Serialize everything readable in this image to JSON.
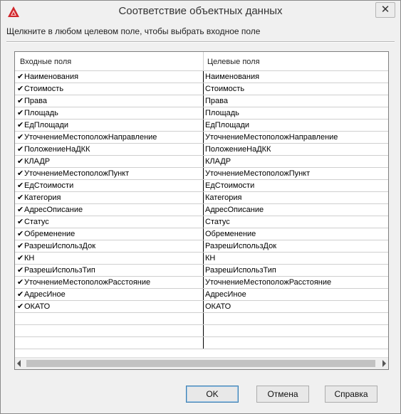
{
  "window": {
    "title": "Соответствие объектных данных",
    "close_glyph": "✕",
    "app_icon": "autocad-logo-icon"
  },
  "instruction": "Щелкните в любом целевом поле, чтобы выбрать входное поле",
  "table": {
    "headers": {
      "input": "Входные поля",
      "target": "Целевые поля"
    },
    "check_glyph": "✔",
    "rows": [
      {
        "checked": true,
        "input": "Наименования",
        "target": "Наименования"
      },
      {
        "checked": true,
        "input": "Стоимость",
        "target": "Стоимость"
      },
      {
        "checked": true,
        "input": "Права",
        "target": "Права"
      },
      {
        "checked": true,
        "input": "Площадь",
        "target": "Площадь"
      },
      {
        "checked": true,
        "input": "ЕдПлощади",
        "target": "ЕдПлощади"
      },
      {
        "checked": true,
        "input": "УточнениеМестоположНаправление",
        "target": "УточнениеМестоположНаправление"
      },
      {
        "checked": true,
        "input": "ПоложениеНаДКК",
        "target": "ПоложениеНаДКК"
      },
      {
        "checked": true,
        "input": "КЛАДР",
        "target": "КЛАДР"
      },
      {
        "checked": true,
        "input": "УточнениеМестоположПункт",
        "target": "УточнениеМестоположПункт"
      },
      {
        "checked": true,
        "input": "ЕдСтоимости",
        "target": "ЕдСтоимости"
      },
      {
        "checked": true,
        "input": "Категория",
        "target": "Категория"
      },
      {
        "checked": true,
        "input": "АдресОписание",
        "target": "АдресОписание"
      },
      {
        "checked": true,
        "input": "Статус",
        "target": "Статус"
      },
      {
        "checked": true,
        "input": "Обременение",
        "target": "Обременение"
      },
      {
        "checked": true,
        "input": "РазрешИспользДок",
        "target": "РазрешИспользДок"
      },
      {
        "checked": true,
        "input": "КН",
        "target": "КН"
      },
      {
        "checked": true,
        "input": "РазрешИспользТип",
        "target": "РазрешИспользТип"
      },
      {
        "checked": true,
        "input": "УточнениеМестоположРасстояние",
        "target": "УточнениеМестоположРасстояние"
      },
      {
        "checked": true,
        "input": "АдресИное",
        "target": "АдресИное"
      },
      {
        "checked": true,
        "input": "ОКАТО",
        "target": "ОКАТО"
      }
    ]
  },
  "buttons": {
    "ok": "OK",
    "cancel": "Отмена",
    "help": "Справка"
  }
}
